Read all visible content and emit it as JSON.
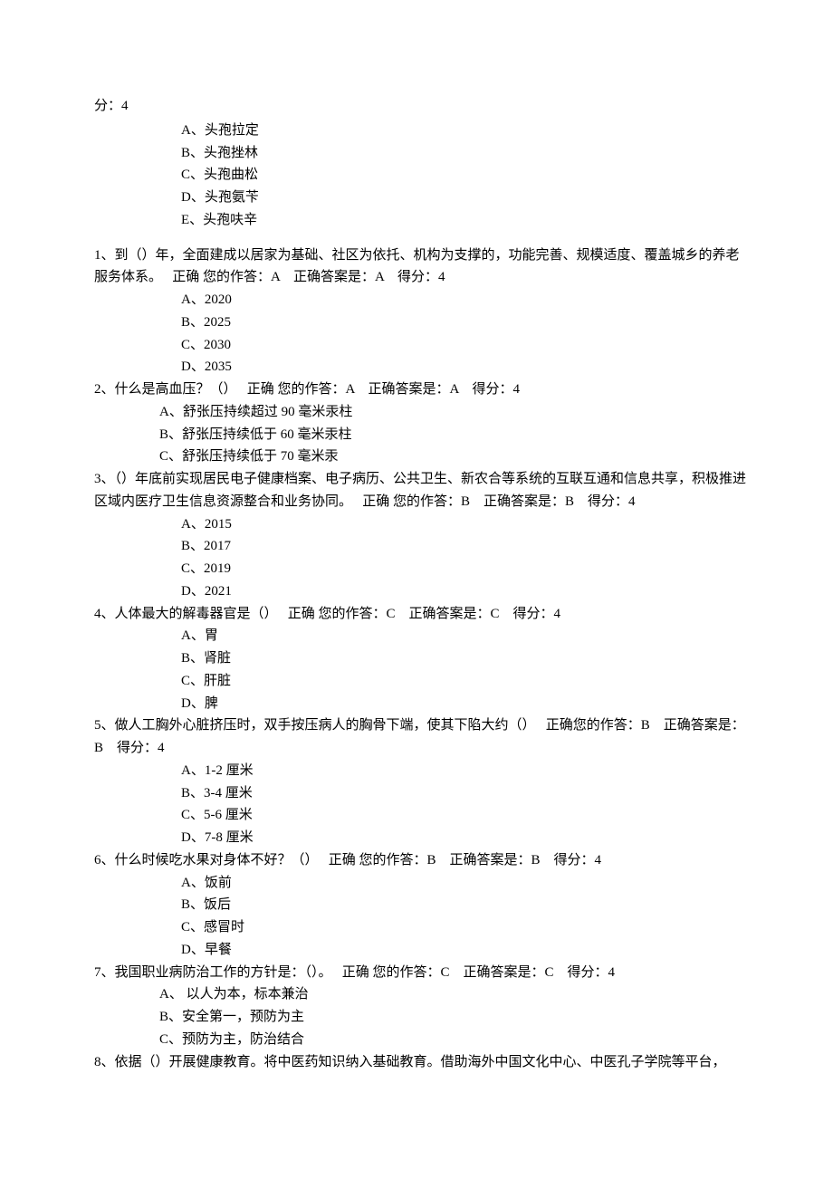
{
  "intro": {
    "score_prefix": "分：4",
    "options": [
      "A、头孢拉定",
      "B、头孢挫林",
      "C、头孢曲松",
      "D、头孢氨苄",
      "E、头孢呋辛"
    ]
  },
  "questions": [
    {
      "num": "1、",
      "text": "到（）年，全面建成以居家为基础、社区为依托、机构为支撑的，功能完善、规模适度、覆盖城乡的养老服务体系。　 正确 您的作答：A　正确答案是：A　得分：4",
      "options": [
        "A、2020",
        "B、2025",
        "C、2030",
        "D、2035"
      ],
      "indent": false
    },
    {
      "num": " 2、",
      "text": "什么是高血压？（）　 正确 您的作答：A　正确答案是：A　得分：4",
      "options": [
        "A、舒张压持续超过 90 毫米汞柱",
        "B、舒张压持续低于 60 毫米汞柱",
        "C、舒张压持续低于 70 毫米汞"
      ],
      "optClass": "shallow",
      "indent": false
    },
    {
      "num": "3、",
      "text": "（）年底前实现居民电子健康档案、电子病历、公共卫生、新农合等系统的互联互通和信息共享，积极推进区域内医疗卫生信息资源整合和业务协同。　 正确 您的作答：B　正确答案是：B　得分：4",
      "options": [
        "A、2015",
        "B、2017",
        "C、2019",
        "D、2021"
      ],
      "indent": false
    },
    {
      "num": " 4、",
      "text": "人体最大的解毒器官是（）　 正确 您的作答：C　正确答案是：C　得分：4",
      "options": [
        "A、胃",
        "B、肾脏",
        "C、肝脏",
        "D、脾"
      ],
      "indent": false
    },
    {
      "num": "5、",
      "text": "做人工胸外心脏挤压时，双手按压病人的胸骨下端，使其下陷大约（）　 正确您的作答：B　正确答案是：B　得分：4",
      "options": [
        "A、1-2 厘米",
        "B、3-4 厘米",
        "C、5-6 厘米",
        "D、7-8 厘米"
      ],
      "indent": false
    },
    {
      "num": " 6、",
      "text": "什么时候吃水果对身体不好？（）　 正确 您的作答：B　正确答案是：B　得分：4",
      "options": [
        "A、饭前",
        "B、饭后",
        "C、感冒时",
        "D、早餐"
      ],
      "indent": false
    },
    {
      "num": "7、",
      "text": "我国职业病防治工作的方针是：（）。　 正确 您的作答：C　正确答案是：C　得分：4",
      "options": [
        "A、 以人为本，标本兼治",
        "B、安全第一，预防为主",
        "C、预防为主，防治结合"
      ],
      "optClass": "shallow",
      "indent": false
    },
    {
      "num": "8、",
      "text": "依据（）开展健康教育。将中医药知识纳入基础教育。借助海外中国文化中心、中医孔子学院等平台，",
      "options": [],
      "indent": false
    }
  ]
}
